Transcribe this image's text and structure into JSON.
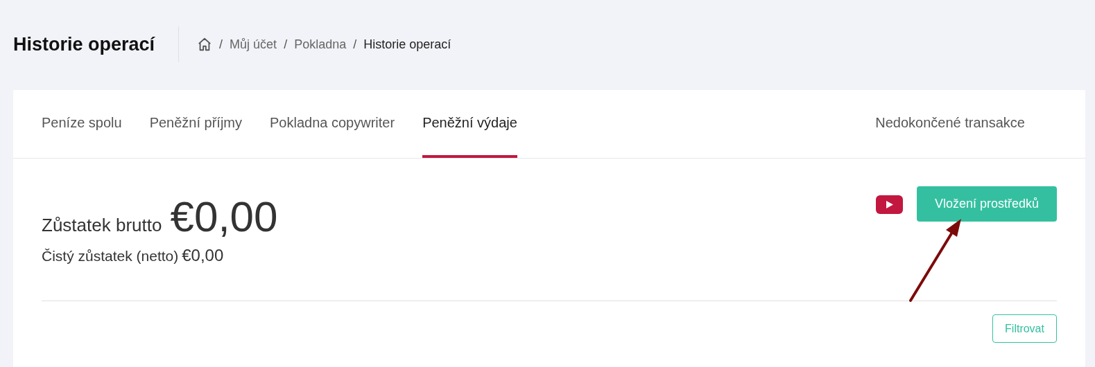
{
  "page_title": "Historie operací",
  "breadcrumb": [
    {
      "separator": "/",
      "label": "Můj účet",
      "current": false
    },
    {
      "separator": "/",
      "label": "Pokladna",
      "current": false
    },
    {
      "separator": "/",
      "label": "Historie operací",
      "current": true
    }
  ],
  "tabs": [
    {
      "label": "Peníze spolu",
      "selected": false
    },
    {
      "label": "Peněžní příjmy",
      "selected": false
    },
    {
      "label": "Pokladna copywriter",
      "selected": false
    },
    {
      "label": "Peněžní výdaje",
      "selected": true
    }
  ],
  "side_tabs": [
    {
      "label": "Nedokončené transakce",
      "selected": false
    }
  ],
  "balance": {
    "gross_label": "Zůstatek brutto",
    "gross_value": "€0,00",
    "net_label": "Čistý zůstatek (netto)",
    "net_value": "€0,00"
  },
  "deposit_button": "Vložení prostředků",
  "filter_button": "Filtrovat"
}
